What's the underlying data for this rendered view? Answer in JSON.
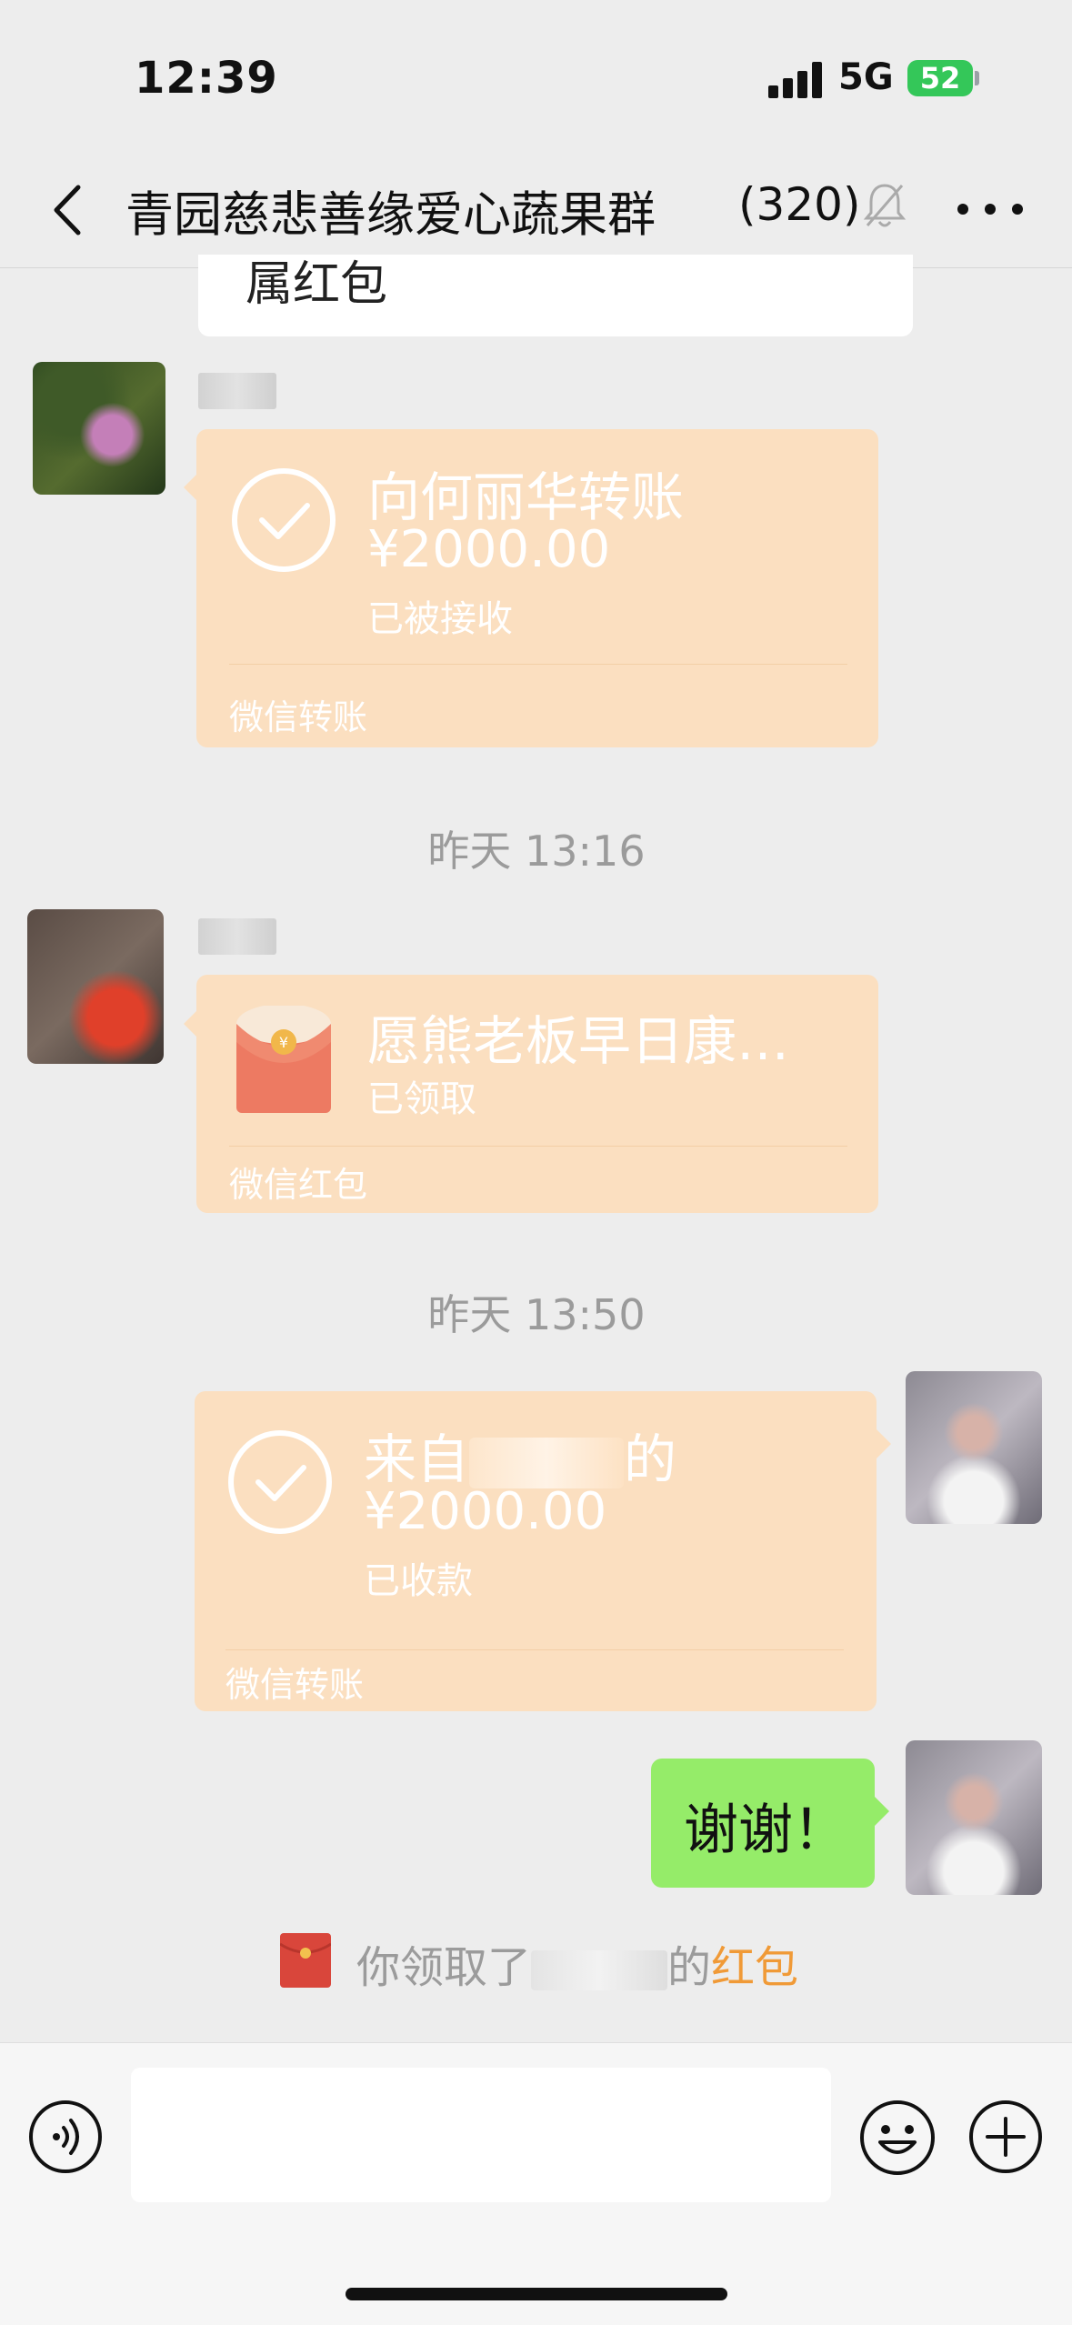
{
  "status_bar": {
    "time": "12:39",
    "network": "5G",
    "battery": "52"
  },
  "header": {
    "title": "青园慈悲善缘爱心蔬果群",
    "member_count": "(320)"
  },
  "messages": {
    "partial_text": "属红包",
    "transfer_received": {
      "title": "向何丽华转账",
      "amount": "¥2000.00",
      "status": "已被接收",
      "footer": "微信转账"
    },
    "timestamp_1": "昨天 13:16",
    "red_packet": {
      "title": "愿熊老板早日康…",
      "status": "已领取",
      "footer": "微信红包"
    },
    "timestamp_2": "昨天 13:50",
    "transfer_from": {
      "title_prefix": "来自",
      "title_suffix": "的",
      "amount": "¥2000.00",
      "status": "已收款",
      "footer": "微信转账"
    },
    "self_text": "谢谢！",
    "system_notice": {
      "prefix": "你领取了",
      "suffix": "的",
      "link": "红包"
    }
  },
  "colors": {
    "transfer_card": "#fbdfc0",
    "self_bubble": "#95ec69",
    "link": "#f09a37",
    "battery": "#34c759"
  }
}
